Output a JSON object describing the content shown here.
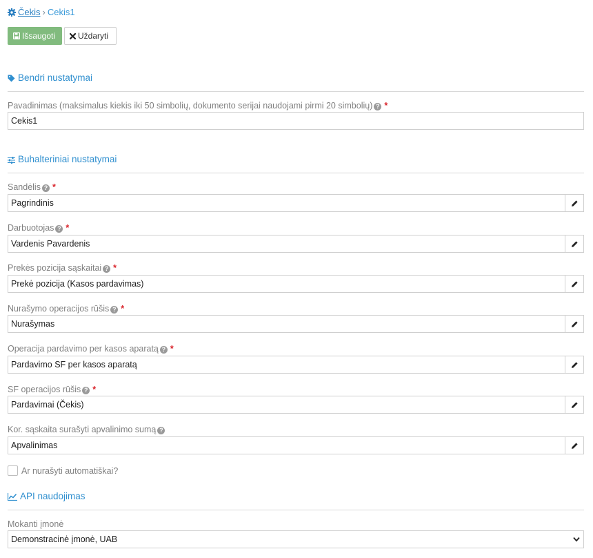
{
  "breadcrumb": {
    "root": "Čekis",
    "separator": "›",
    "current": "Cekis1"
  },
  "toolbar": {
    "save_label": "Išsaugoti",
    "close_label": "Uždaryti"
  },
  "sections": {
    "general": {
      "title": "Bendri nustatymai"
    },
    "accounting": {
      "title": "Buhalteriniai nustatymai"
    },
    "api": {
      "title": "API naudojimas"
    }
  },
  "fields": {
    "name": {
      "label": "Pavadinimas (maksimalus kiekis iki 50 simbolių, dokumento serijai naudojami pirmi 20 simbolių)",
      "value": "Cekis1",
      "required_mark": "*"
    },
    "warehouse": {
      "label": "Sandėlis",
      "value": "Pagrindinis",
      "required_mark": "*"
    },
    "employee": {
      "label": "Darbuotojas",
      "value": "Vardenis Pavardenis",
      "required_mark": "*"
    },
    "item_position": {
      "label": "Prekės pozicija sąskaitai",
      "value": "Prekė pozicija (Kasos pardavimas)",
      "required_mark": "*"
    },
    "writeoff_type": {
      "label": "Nurašymo operacijos rūšis",
      "value": "Nurašymas",
      "required_mark": "*"
    },
    "sale_operation": {
      "label": "Operacija pardavimo per kasos aparatą",
      "value": "Pardavimo SF per kasos aparatą",
      "required_mark": "*"
    },
    "invoice_type": {
      "label": "SF operacijos rūšis",
      "value": "Pardavimai (Čekis)",
      "required_mark": "*"
    },
    "rounding_account": {
      "label": "Kor. sąskaita surašyti apvalinimo sumą",
      "value": "Apvalinimas"
    },
    "auto_writeoff": {
      "label": "Ar nurašyti automatiškai?",
      "checked": false
    },
    "paying_company": {
      "label": "Mokanti įmonė",
      "selected": "Demonstracinė įmonė, UAB"
    }
  },
  "help_glyph": "?",
  "colors": {
    "accent": "#2f8fcf",
    "save": "#81bb7e",
    "required": "#d9242b"
  },
  "icons": [
    "gear-icon",
    "save-icon",
    "close-icon",
    "tag-icon",
    "sliders-icon",
    "chart-line-icon",
    "pencil-icon",
    "chevron-down-icon",
    "help-icon"
  ]
}
